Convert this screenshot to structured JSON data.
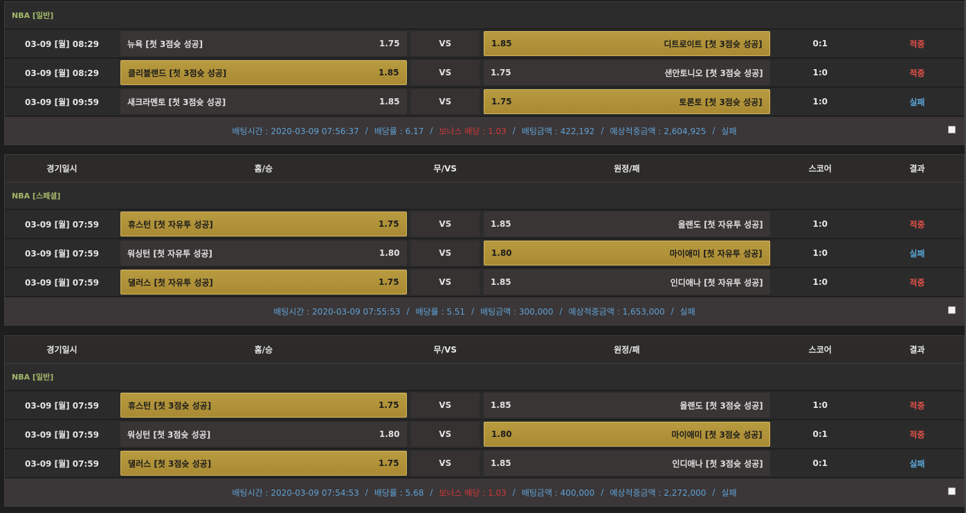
{
  "headers": {
    "date": "경기일시",
    "home": "홈/승",
    "vs": "무/VS",
    "away": "원정/패",
    "score": "스코어",
    "result": "결과"
  },
  "slips": [
    {
      "league": "NBA [일반]",
      "games": [
        {
          "date": "03-09 [월] 08:29",
          "home": "뉴욕 [첫 3점슛 성공]",
          "home_odds": "1.75",
          "vs": "VS",
          "away_odds": "1.85",
          "away": "디트로이트 [첫 3점슛 성공]",
          "score": "0:1",
          "result": "적중",
          "selected": "away"
        },
        {
          "date": "03-09 [월] 08:29",
          "home": "클리블랜드 [첫 3점슛 성공]",
          "home_odds": "1.85",
          "vs": "VS",
          "away_odds": "1.75",
          "away": "샌안토니오 [첫 3점슛 성공]",
          "score": "1:0",
          "result": "적중",
          "selected": "home"
        },
        {
          "date": "03-09 [월] 09:59",
          "home": "새크라멘토 [첫 3점슛 성공]",
          "home_odds": "1.85",
          "vs": "VS",
          "away_odds": "1.75",
          "away": "토론토 [첫 3점슛 성공]",
          "score": "1:0",
          "result": "실패",
          "selected": "away"
        }
      ],
      "summary": {
        "bet_time": "배팅시간 : 2020-03-09 07:56:37",
        "odds": "배당률 : 6.17",
        "bonus": "보너스 배당 : 1.03",
        "amount": "배팅금액 : 422,192",
        "expected": "예상적중금액 : 2,604,925",
        "status": "실패"
      }
    },
    {
      "league": "NBA [스페셜]",
      "games": [
        {
          "date": "03-09 [월] 07:59",
          "home": "휴스턴 [첫 자유투 성공]",
          "home_odds": "1.75",
          "vs": "VS",
          "away_odds": "1.85",
          "away": "올랜도 [첫 자유투 성공]",
          "score": "1:0",
          "result": "적중",
          "selected": "home"
        },
        {
          "date": "03-09 [월] 07:59",
          "home": "워싱턴 [첫 자유투 성공]",
          "home_odds": "1.80",
          "vs": "VS",
          "away_odds": "1.80",
          "away": "마이애미 [첫 자유투 성공]",
          "score": "1:0",
          "result": "실패",
          "selected": "away"
        },
        {
          "date": "03-09 [월] 07:59",
          "home": "댈러스 [첫 자유투 성공]",
          "home_odds": "1.75",
          "vs": "VS",
          "away_odds": "1.85",
          "away": "인디애나 [첫 자유투 성공]",
          "score": "1:0",
          "result": "적중",
          "selected": "home"
        }
      ],
      "summary": {
        "bet_time": "배팅시간 : 2020-03-09 07:55:53",
        "odds": "배당률 : 5.51",
        "amount": "배팅금액 : 300,000",
        "expected": "예상적중금액 : 1,653,000",
        "status": "실패"
      }
    },
    {
      "league": "NBA [일반]",
      "games": [
        {
          "date": "03-09 [월] 07:59",
          "home": "휴스턴 [첫 3점슛 성공]",
          "home_odds": "1.75",
          "vs": "VS",
          "away_odds": "1.85",
          "away": "올랜도 [첫 3점슛 성공]",
          "score": "1:0",
          "result": "적중",
          "selected": "home"
        },
        {
          "date": "03-09 [월] 07:59",
          "home": "워싱턴 [첫 3점슛 성공]",
          "home_odds": "1.80",
          "vs": "VS",
          "away_odds": "1.80",
          "away": "마이애미 [첫 3점슛 성공]",
          "score": "0:1",
          "result": "적중",
          "selected": "away"
        },
        {
          "date": "03-09 [월] 07:59",
          "home": "댈러스 [첫 3점슛 성공]",
          "home_odds": "1.75",
          "vs": "VS",
          "away_odds": "1.85",
          "away": "인디애나 [첫 3점슛 성공]",
          "score": "0:1",
          "result": "실패",
          "selected": "home"
        }
      ],
      "summary": {
        "bet_time": "배팅시간 : 2020-03-09 07:54:53",
        "odds": "배당률 : 5.68",
        "bonus": "보너스 배당 : 1.03",
        "amount": "배팅금액 : 400,000",
        "expected": "예상적중금액 : 2,272,000",
        "status": "실패"
      }
    }
  ],
  "colors": {
    "win": "#e8524a",
    "lose": "#5aa6d8",
    "selected_bg": "#b89b40"
  }
}
